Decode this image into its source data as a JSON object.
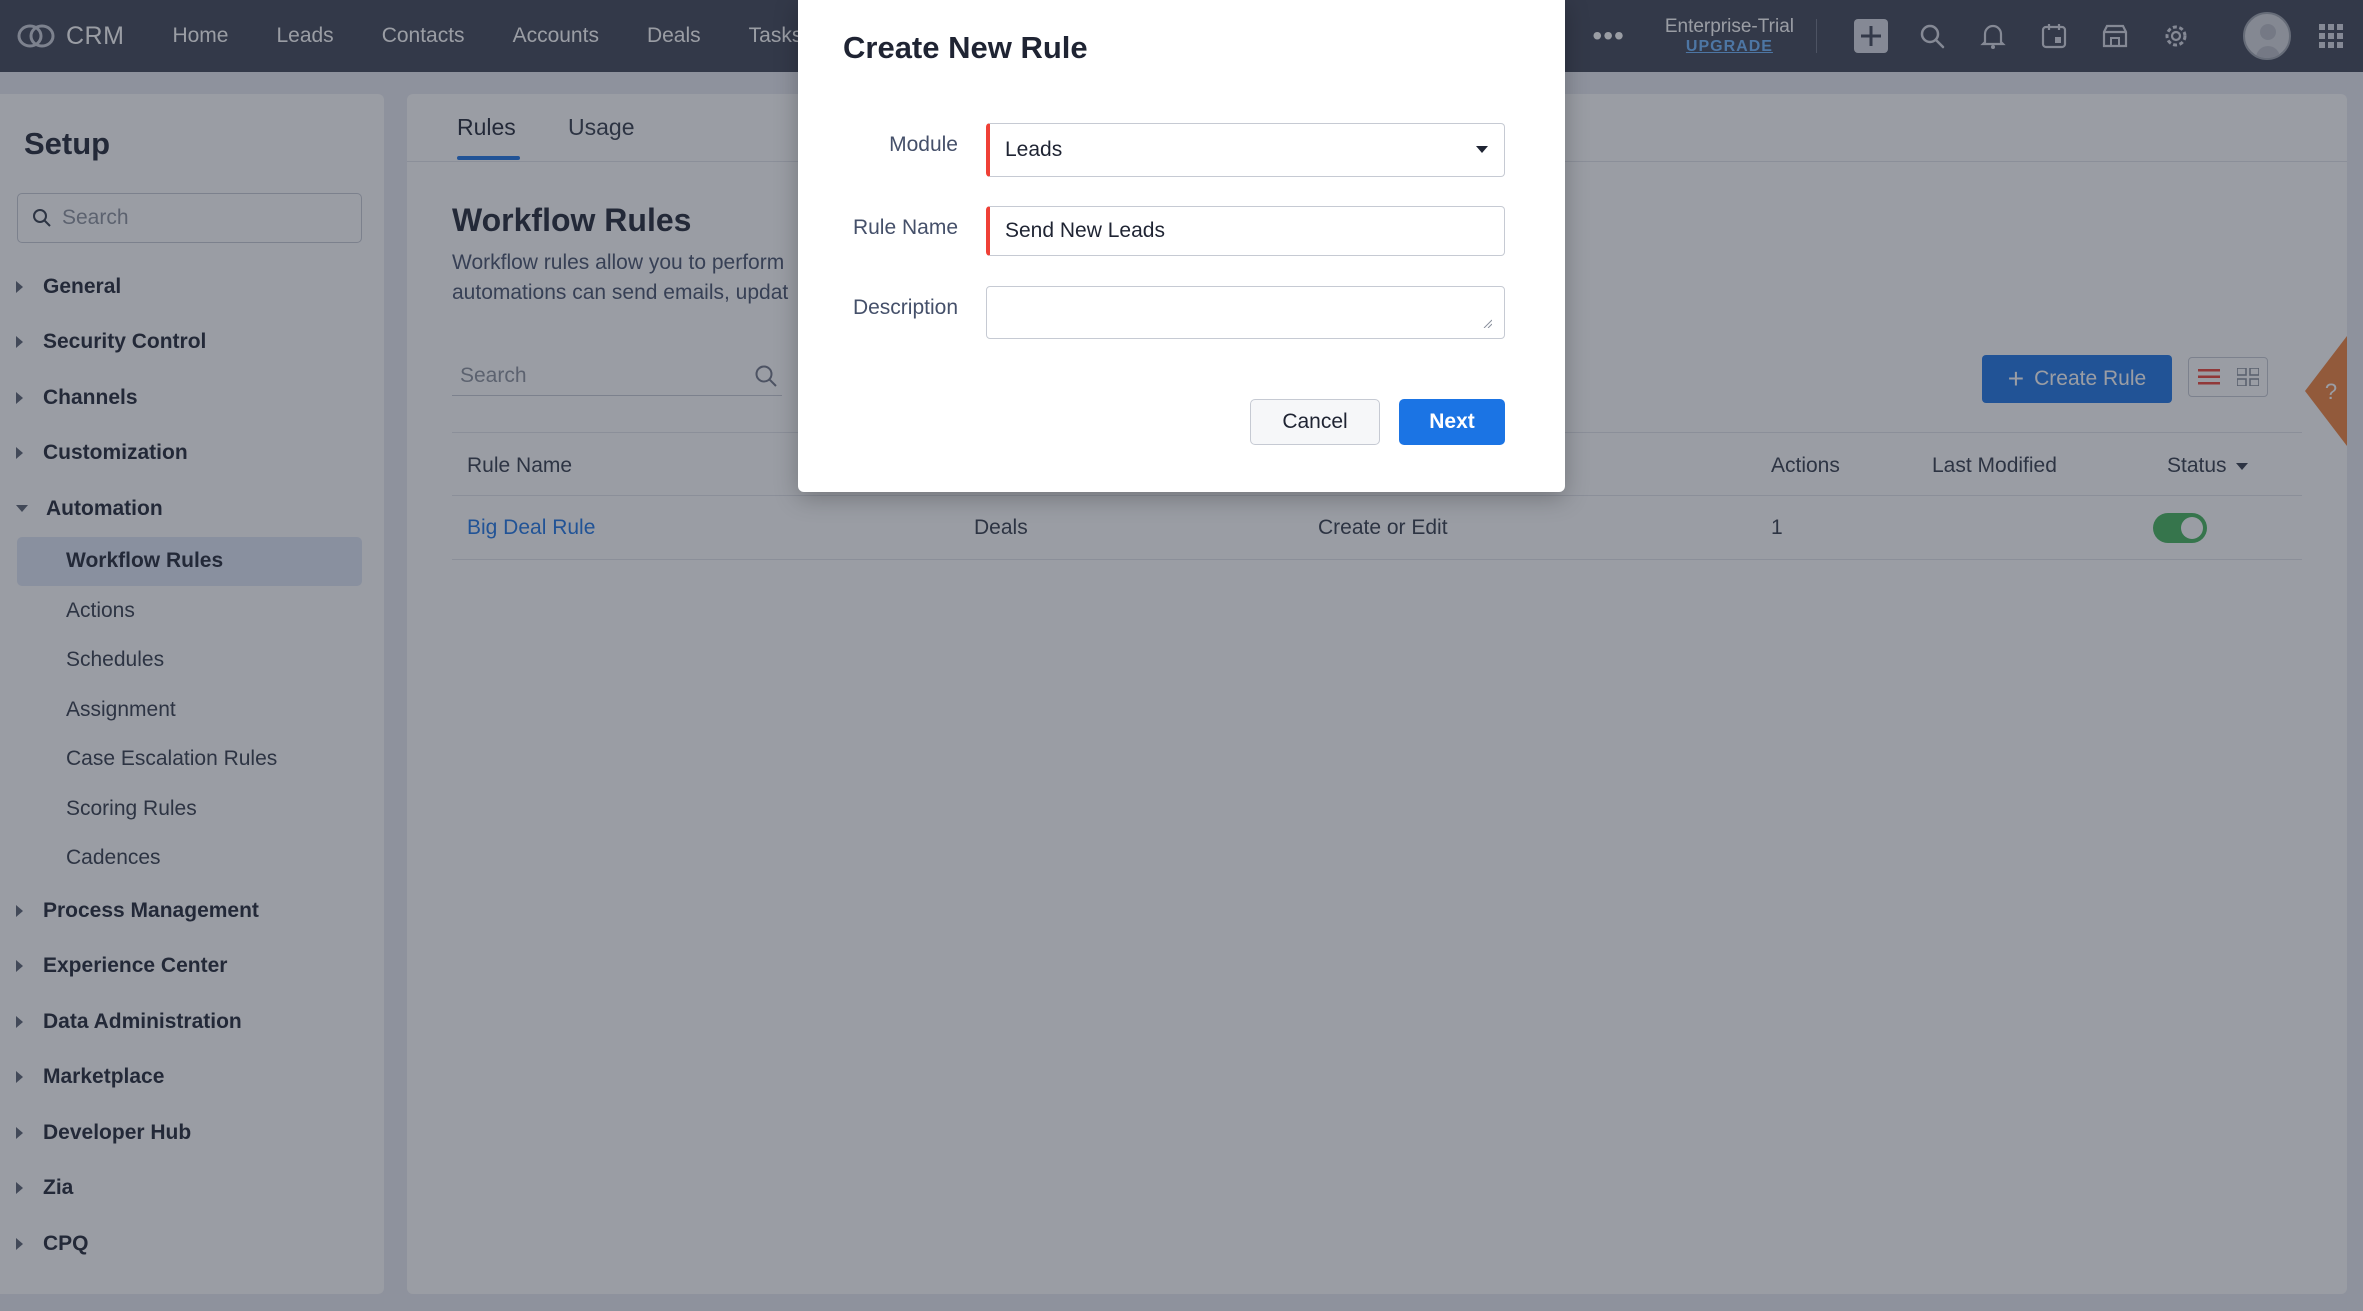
{
  "app": {
    "name": "CRM"
  },
  "nav": {
    "items": [
      "Home",
      "Leads",
      "Contacts",
      "Accounts",
      "Deals",
      "Tasks"
    ]
  },
  "top": {
    "more": "•••",
    "edition": "Enterprise-Trial",
    "upgrade": "UPGRADE",
    "icons": [
      "add-icon",
      "search-icon",
      "bell-icon",
      "calendar-icon",
      "store-icon",
      "gear-icon",
      "avatar",
      "apps-grid-icon"
    ]
  },
  "sidebar": {
    "title": "Setup",
    "search_placeholder": "Search",
    "sections": [
      {
        "label": "General",
        "expanded": false
      },
      {
        "label": "Security Control",
        "expanded": false
      },
      {
        "label": "Channels",
        "expanded": false
      },
      {
        "label": "Customization",
        "expanded": false
      },
      {
        "label": "Automation",
        "expanded": true,
        "children": [
          "Workflow Rules",
          "Actions",
          "Schedules",
          "Assignment",
          "Case Escalation Rules",
          "Scoring Rules",
          "Cadences"
        ],
        "active_child": "Workflow Rules"
      },
      {
        "label": "Process Management",
        "expanded": false
      },
      {
        "label": "Experience Center",
        "expanded": false
      },
      {
        "label": "Data Administration",
        "expanded": false
      },
      {
        "label": "Marketplace",
        "expanded": false
      },
      {
        "label": "Developer Hub",
        "expanded": false
      },
      {
        "label": "Zia",
        "expanded": false
      },
      {
        "label": "CPQ",
        "expanded": false
      }
    ]
  },
  "main": {
    "tabs": [
      "Rules",
      "Usage"
    ],
    "active_tab": "Rules",
    "title": "Workflow Rules",
    "description_line1": "Workflow rules allow you to perform",
    "description_line2": "automations can send emails, updat",
    "search_placeholder": "Search",
    "create_button": "Create Rule",
    "table": {
      "columns": [
        "Rule Name",
        "Actions",
        "Last Modified",
        "Status"
      ],
      "rows": [
        {
          "rule_name": "Big Deal Rule",
          "module": "Deals",
          "trigger": "Create or Edit",
          "actions": "1",
          "last_modified": "",
          "status_on": true
        }
      ]
    },
    "help_label": "?"
  },
  "dialog": {
    "title": "Create New Rule",
    "fields": {
      "module_label": "Module",
      "module_value": "Leads",
      "rule_name_label": "Rule Name",
      "rule_name_value": "Send New Leads",
      "description_label": "Description",
      "description_value": ""
    },
    "cancel": "Cancel",
    "next": "Next"
  },
  "colors": {
    "topbar": "#3d4253",
    "accent": "#1b74e4",
    "required": "#ef4036",
    "toggle_on": "#42b35a",
    "overlay": "rgba(40,46,62,0.47)"
  }
}
